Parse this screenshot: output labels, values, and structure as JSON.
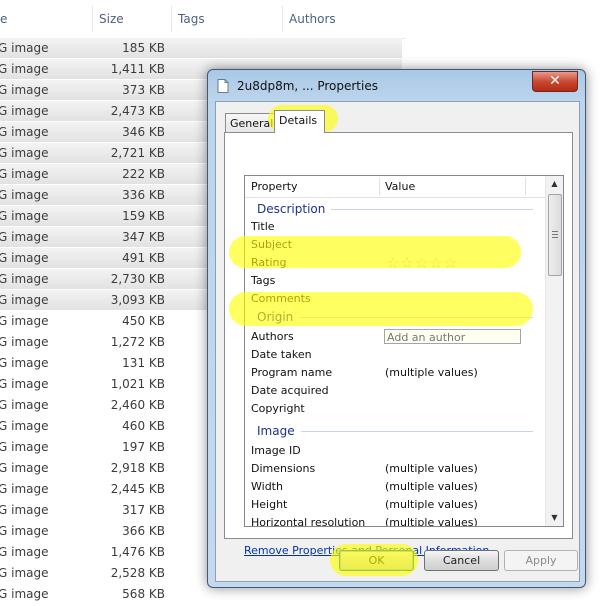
{
  "explorer": {
    "columns": {
      "name_fragment": "e",
      "size": "Size",
      "tags": "Tags",
      "authors": "Authors"
    },
    "rows": [
      {
        "type": "G image",
        "size": "185 KB",
        "selected": true
      },
      {
        "type": "G image",
        "size": "1,411 KB",
        "selected": true
      },
      {
        "type": "G image",
        "size": "373 KB",
        "selected": true
      },
      {
        "type": "G image",
        "size": "2,473 KB",
        "selected": true
      },
      {
        "type": "G image",
        "size": "346 KB",
        "selected": true
      },
      {
        "type": "G image",
        "size": "2,721 KB",
        "selected": true
      },
      {
        "type": "G image",
        "size": "222 KB",
        "selected": true
      },
      {
        "type": "G image",
        "size": "336 KB",
        "selected": true
      },
      {
        "type": "G image",
        "size": "159 KB",
        "selected": true
      },
      {
        "type": "G image",
        "size": "347 KB",
        "selected": true
      },
      {
        "type": "G image",
        "size": "491 KB",
        "selected": true
      },
      {
        "type": "G image",
        "size": "2,730 KB",
        "selected": true
      },
      {
        "type": "G image",
        "size": "3,093 KB",
        "selected": true
      },
      {
        "type": "G image",
        "size": "450 KB",
        "selected": false
      },
      {
        "type": "G image",
        "size": "1,272 KB",
        "selected": false
      },
      {
        "type": "G image",
        "size": "131 KB",
        "selected": false
      },
      {
        "type": "G image",
        "size": "1,021 KB",
        "selected": false
      },
      {
        "type": "G image",
        "size": "2,460 KB",
        "selected": false
      },
      {
        "type": "G image",
        "size": "460 KB",
        "selected": false
      },
      {
        "type": "G image",
        "size": "197 KB",
        "selected": false
      },
      {
        "type": "G image",
        "size": "2,918 KB",
        "selected": false
      },
      {
        "type": "G image",
        "size": "2,445 KB",
        "selected": false
      },
      {
        "type": "G image",
        "size": "317 KB",
        "selected": false
      },
      {
        "type": "G image",
        "size": "366 KB",
        "selected": false
      },
      {
        "type": "G image",
        "size": "1,476 KB",
        "selected": false
      },
      {
        "type": "G image",
        "size": "2,528 KB",
        "selected": false
      },
      {
        "type": "G image",
        "size": "568 KB",
        "selected": false
      }
    ]
  },
  "dialog": {
    "title": "2u8dp8m, ... Properties",
    "close_glyph": "✕",
    "tabs": {
      "general": "General",
      "details": "Details"
    },
    "list_header": {
      "property": "Property",
      "value": "Value"
    },
    "groups": {
      "description": "Description",
      "origin": "Origin",
      "image": "Image"
    },
    "rows": {
      "title": "Title",
      "subject": "Subject",
      "rating": "Rating",
      "rating_stars": "☆☆☆☆☆",
      "rating_value": 0,
      "tags": "Tags",
      "comments": "Comments",
      "authors": "Authors",
      "authors_placeholder": "Add an author",
      "date_taken": "Date taken",
      "program_name": "Program name",
      "program_name_value": "(multiple values)",
      "date_acquired": "Date acquired",
      "copyright": "Copyright",
      "image_id": "Image ID",
      "dimensions": "Dimensions",
      "dimensions_value": "(multiple values)",
      "width": "Width",
      "width_value": "(multiple values)",
      "height": "Height",
      "height_value": "(multiple values)",
      "horizontal_resolution": "Horizontal resolution",
      "horizontal_resolution_value": "(multiple values)"
    },
    "scroll": {
      "up": "▲",
      "down": "▼"
    },
    "remove_link": "Remove Properties and Personal Information",
    "buttons": {
      "ok": "OK",
      "cancel": "Cancel",
      "apply": "Apply"
    }
  },
  "highlight_color": "#ffff00"
}
